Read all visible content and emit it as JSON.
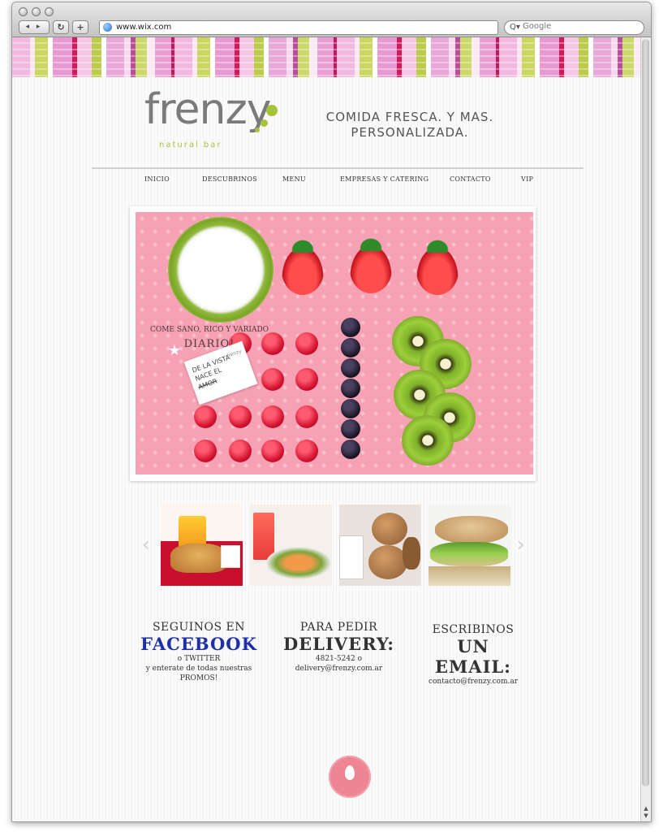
{
  "browser": {
    "url": "www.wix.com",
    "search_placeholder": "Google",
    "back_forward": "◂ ▸",
    "reload": "↻",
    "add": "+",
    "search_icon": "Q▾"
  },
  "header": {
    "logo_word": "frenzy",
    "logo_sub": "natural bar",
    "tagline_line1": "COMIDA FRESCA. Y MAS.",
    "tagline_line2": "PERSONALIZADA."
  },
  "menu": {
    "items": [
      {
        "label": "INICIO"
      },
      {
        "label": "DESCUBRINOS"
      },
      {
        "label": "MENU"
      },
      {
        "label": "EMPRESAS Y CATERING"
      },
      {
        "label": "CONTACTO"
      },
      {
        "label": "VIP"
      }
    ]
  },
  "hero": {
    "line1": "COME SANO, RICO Y VARIADO",
    "line2": "DIARIO!",
    "tag_line1": "DE LA VISTA",
    "tag_line2": "NACE EL",
    "tag_line3": "AMOR",
    "tag_brand": "frenzy"
  },
  "carousel": {
    "prev": "‹",
    "next": "›",
    "items": [
      "juice-croissant",
      "salad-drink",
      "muffins-berries",
      "sandwich"
    ]
  },
  "columns": {
    "facebook": {
      "line1": "SEGUINOS EN",
      "link": "FACEBOOK",
      "line2": "o TWITTER",
      "line3": "y enterate de todas nuestras",
      "line4": "PROMOS!"
    },
    "delivery": {
      "line1": "PARA PEDIR",
      "big": "DELIVERY:",
      "phone": "4821-5242 o",
      "email": "delivery@frenzy.com.ar"
    },
    "email": {
      "line1": "ESCRIBINOS",
      "big": "UN EMAIL:",
      "address": "contacto@frenzy.com.ar"
    }
  },
  "colors": {
    "accent_green": "#a6c43a",
    "facebook_blue": "#1f2fa8",
    "footer_pink": "#ee8592"
  }
}
